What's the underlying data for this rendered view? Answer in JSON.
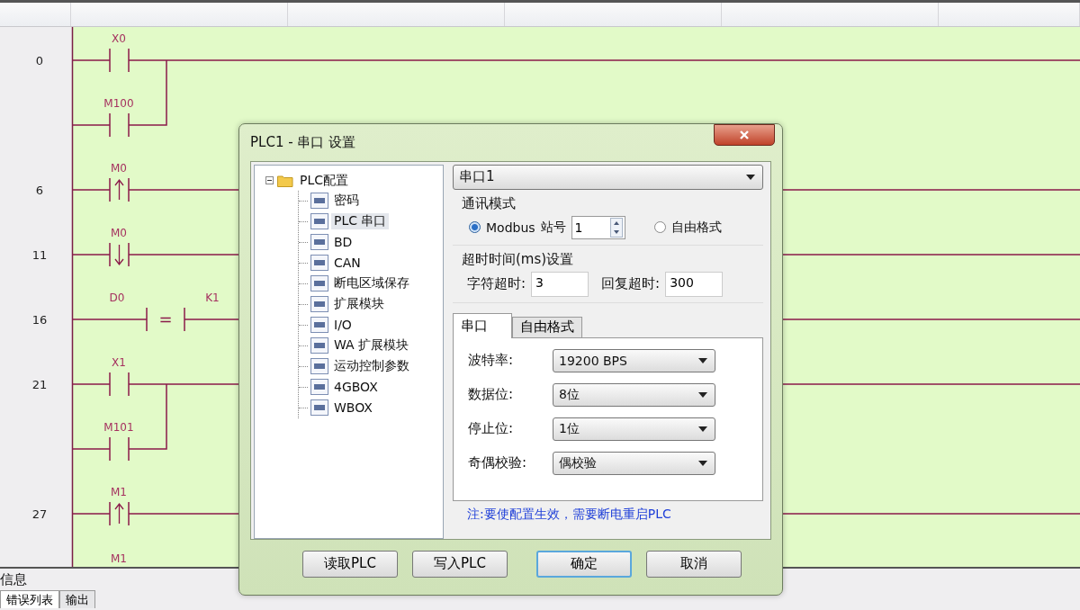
{
  "ladder": {
    "rungs": [
      {
        "step": "0",
        "kind": "no",
        "label": "X0",
        "branch": {
          "kind": "no",
          "label": "M100"
        }
      },
      {
        "step": "6",
        "kind": "rise",
        "label": "M0"
      },
      {
        "step": "11",
        "kind": "fall",
        "label": "M0"
      },
      {
        "step": "16",
        "kind": "compare",
        "label": "D0",
        "operator": "=",
        "operand": "K1"
      },
      {
        "step": "21",
        "kind": "no",
        "label": "X1",
        "branch": {
          "kind": "no",
          "label": "M101"
        }
      },
      {
        "step": "27",
        "kind": "rise",
        "label": "M1"
      }
    ],
    "trailing_label": "M1"
  },
  "dialog": {
    "title": "PLC1 - 串口 设置",
    "tree": {
      "label": "PLC配置",
      "expanded": true,
      "children": [
        {
          "label": "密码",
          "selected": false
        },
        {
          "label": "PLC 串口",
          "selected": true
        },
        {
          "label": "BD",
          "selected": false
        },
        {
          "label": "CAN",
          "selected": false
        },
        {
          "label": "断电区域保存",
          "selected": false
        },
        {
          "label": "扩展模块",
          "selected": false
        },
        {
          "label": "I/O",
          "selected": false
        },
        {
          "label": "WA 扩展模块",
          "selected": false
        },
        {
          "label": "运动控制参数",
          "selected": false
        },
        {
          "label": "4GBOX",
          "selected": false
        },
        {
          "label": "WBOX",
          "selected": false
        }
      ]
    },
    "port": "串口1",
    "comm_mode": {
      "title": "通讯模式",
      "options": [
        {
          "label": "Modbus",
          "selected": true,
          "station_label": "站号",
          "station": "1"
        },
        {
          "label": "自由格式",
          "selected": false
        }
      ]
    },
    "timeout": {
      "title": "超时时间(ms)设置",
      "char_label": "字符超时:",
      "char_value": "3",
      "reply_label": "回复超时:",
      "reply_value": "300"
    },
    "tabs": [
      {
        "label": "串口",
        "selected": true
      },
      {
        "label": "自由格式",
        "selected": false
      }
    ],
    "settings": [
      {
        "label": "波特率:",
        "value": "19200 BPS"
      },
      {
        "label": "数据位:",
        "value": "8位"
      },
      {
        "label": "停止位:",
        "value": "1位"
      },
      {
        "label": "奇偶校验:",
        "value": "偶校验"
      }
    ],
    "note": "注:要使配置生效，需要断电重启PLC",
    "buttons": [
      {
        "label": "读取PLC",
        "default": false
      },
      {
        "label": "写入PLC",
        "default": false
      },
      {
        "label": "确定",
        "default": true
      },
      {
        "label": "取消",
        "default": false
      }
    ]
  },
  "info_panel": {
    "title": "信息",
    "tabs": [
      {
        "label": "错误列表",
        "selected": true
      },
      {
        "label": "输出",
        "selected": false
      }
    ]
  }
}
